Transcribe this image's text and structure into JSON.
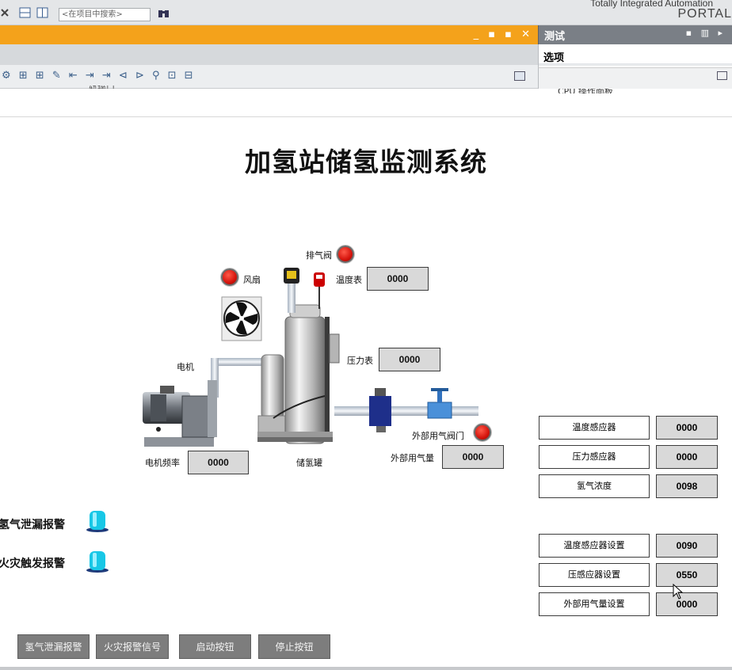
{
  "toolbar": {
    "search_placeholder": "<在项目中搜索>"
  },
  "brand": {
    "line1": "Totally Integrated Automation",
    "line2": "PORTAL"
  },
  "editor": {
    "cut_label": "轨接口"
  },
  "task_card": {
    "title": "测试",
    "section": "选项",
    "cut_label": "CPU 操作面板"
  },
  "hmi": {
    "title": "加氢站储氢监测系统",
    "labels": {
      "exhaust_valve": "排气阀",
      "fan": "风扇",
      "temp_gauge": "温度表",
      "pressure_gauge": "压力表",
      "motor": "电机",
      "motor_freq": "电机频率",
      "tank": "储氢罐",
      "ext_valve": "外部用气阀门",
      "ext_flow": "外部用气量"
    },
    "values": {
      "temp_gauge": "0000",
      "pressure_gauge": "0000",
      "motor_freq": "0000",
      "ext_flow": "0000"
    },
    "sensors": [
      {
        "label": "温度感应器",
        "value": "0000"
      },
      {
        "label": "压力感应器",
        "value": "0000"
      },
      {
        "label": "氢气浓度",
        "value": "0098"
      }
    ],
    "settings": [
      {
        "label": "温度感应器设置",
        "value": "0090"
      },
      {
        "label": "压感应器设置",
        "value": "0550"
      },
      {
        "label": "外部用气量设置",
        "value": "0000"
      }
    ],
    "alarms": [
      {
        "label": "氢气泄漏报警"
      },
      {
        "label": "火灾触发报警"
      }
    ],
    "buttons": [
      {
        "label": "氢气泄漏报警"
      },
      {
        "label": "火灾报警信号"
      },
      {
        "label": "启动按钮"
      },
      {
        "label": "停止按钮"
      }
    ]
  },
  "colors": {
    "accent": "#f4a21b",
    "lamp_red": "#d5140c",
    "lamp_cyan": "#18c7e6",
    "button_gray": "#7d7d7d"
  }
}
